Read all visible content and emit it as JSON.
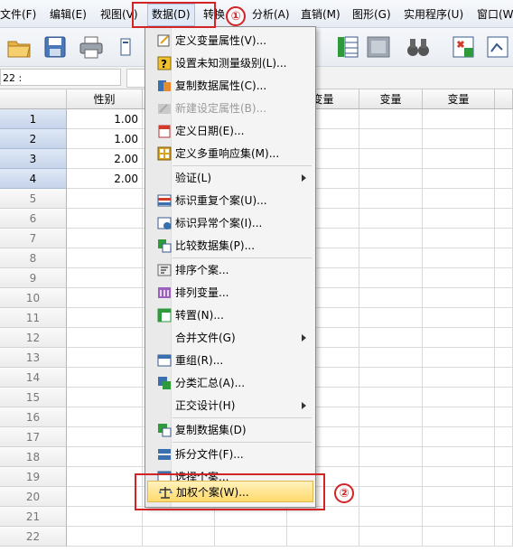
{
  "menubar": {
    "items": [
      {
        "label": "文件(F)"
      },
      {
        "label": "编辑(E)"
      },
      {
        "label": "视图(V)"
      },
      {
        "label": "数据(D)"
      },
      {
        "label": "转换"
      },
      {
        "label": "分析(A)"
      },
      {
        "label": "直销(M)"
      },
      {
        "label": "图形(G)"
      },
      {
        "label": "实用程序(U)"
      },
      {
        "label": "窗口(W"
      }
    ]
  },
  "cell_ref": "22 :",
  "grid": {
    "columns": [
      "性别",
      "变量",
      "变量",
      "变量"
    ],
    "rows": [
      {
        "num": "1",
        "gender": "1.00"
      },
      {
        "num": "2",
        "gender": "1.00"
      },
      {
        "num": "3",
        "gender": "2.00"
      },
      {
        "num": "4",
        "gender": "2.00"
      },
      {
        "num": "5",
        "gender": ""
      },
      {
        "num": "6",
        "gender": ""
      },
      {
        "num": "7",
        "gender": ""
      },
      {
        "num": "8",
        "gender": ""
      },
      {
        "num": "9",
        "gender": ""
      },
      {
        "num": "10",
        "gender": ""
      },
      {
        "num": "11",
        "gender": ""
      },
      {
        "num": "12",
        "gender": ""
      },
      {
        "num": "13",
        "gender": ""
      },
      {
        "num": "14",
        "gender": ""
      },
      {
        "num": "15",
        "gender": ""
      },
      {
        "num": "16",
        "gender": ""
      },
      {
        "num": "17",
        "gender": ""
      },
      {
        "num": "18",
        "gender": ""
      },
      {
        "num": "19",
        "gender": ""
      },
      {
        "num": "20",
        "gender": ""
      },
      {
        "num": "21",
        "gender": ""
      },
      {
        "num": "22",
        "gender": ""
      }
    ]
  },
  "data_menu": {
    "items": [
      {
        "label": "定义变量属性(V)...",
        "icon": "define-variable-icon"
      },
      {
        "label": "设置未知测量级别(L)...",
        "icon": "unknown-measure-icon"
      },
      {
        "label": "复制数据属性(C)...",
        "icon": "copy-data-properties-icon"
      },
      {
        "label": "新建设定属性(B)...",
        "icon": "new-custom-attribute-icon",
        "disabled": true
      },
      {
        "label": "定义日期(E)...",
        "icon": "define-date-icon"
      },
      {
        "label": "定义多重响应集(M)...",
        "icon": "multiple-response-icon"
      },
      {
        "label": "验证(L)",
        "submenu": true
      },
      {
        "label": "标识重复个案(U)...",
        "icon": "duplicate-cases-icon"
      },
      {
        "label": "标识异常个案(I)...",
        "icon": "unusual-cases-icon"
      },
      {
        "label": "比较数据集(P)...",
        "icon": "compare-datasets-icon"
      },
      {
        "label": "排序个案...",
        "icon": "sort-cases-icon"
      },
      {
        "label": "排列变量...",
        "icon": "sort-variables-icon"
      },
      {
        "label": "转置(N)...",
        "icon": "transpose-icon"
      },
      {
        "label": "合并文件(G)",
        "submenu": true
      },
      {
        "label": "重组(R)...",
        "icon": "restructure-icon"
      },
      {
        "label": "分类汇总(A)...",
        "icon": "aggregate-icon"
      },
      {
        "label": "正交设计(H)",
        "submenu": true
      },
      {
        "label": "复制数据集(D)",
        "icon": "copy-dataset-icon"
      },
      {
        "label": "拆分文件(F)...",
        "icon": "split-file-icon"
      },
      {
        "label": "选择个案...",
        "icon": "select-cases-icon"
      },
      {
        "label": "加权个案(W)...",
        "icon": "weight-cases-icon"
      }
    ]
  },
  "annotations": {
    "step1": "①",
    "step2": "②"
  },
  "colors": {
    "annotation_red": "#d22424",
    "highlight_yellow": "#ffd96b",
    "row_header_blue": "#c6d4ea"
  }
}
